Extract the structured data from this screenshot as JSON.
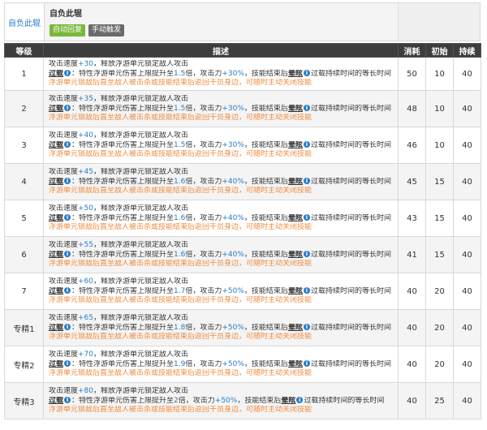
{
  "skill": {
    "name_side": "自负此辊",
    "title": "自负此辊",
    "tag_auto": "自动回复",
    "tag_manual": "手动触发"
  },
  "table": {
    "headers": {
      "level": "等级",
      "desc": "描述",
      "cost": "消耗",
      "init": "初始",
      "dur": "持续"
    },
    "rows": [
      {
        "level": "1",
        "atk_speed": "+30",
        "mult": "1.5",
        "atk": "+30%",
        "cost": "50",
        "init": "10",
        "dur": "40"
      },
      {
        "level": "2",
        "atk_speed": "+35",
        "mult": "1.5",
        "atk": "+30%",
        "cost": "48",
        "init": "10",
        "dur": "40"
      },
      {
        "level": "3",
        "atk_speed": "+40",
        "mult": "1.5",
        "atk": "+30%",
        "cost": "46",
        "init": "10",
        "dur": "40"
      },
      {
        "level": "4",
        "atk_speed": "+45",
        "mult": "1.6",
        "atk": "+40%",
        "cost": "45",
        "init": "15",
        "dur": "40"
      },
      {
        "level": "5",
        "atk_speed": "+50",
        "mult": "1.6",
        "atk": "+40%",
        "cost": "43",
        "init": "15",
        "dur": "40"
      },
      {
        "level": "6",
        "atk_speed": "+55",
        "mult": "1.6",
        "atk": "+40%",
        "cost": "41",
        "init": "15",
        "dur": "40"
      },
      {
        "level": "7",
        "atk_speed": "+60",
        "mult": "1.7",
        "atk": "+50%",
        "cost": "40",
        "init": "20",
        "dur": "40"
      },
      {
        "level": "专精1",
        "atk_speed": "+65",
        "mult": "1.8",
        "atk": "+50%",
        "cost": "40",
        "init": "20",
        "dur": "40"
      },
      {
        "level": "专精2",
        "atk_speed": "+70",
        "mult": "1.9",
        "atk": "+50%",
        "cost": "40",
        "init": "20",
        "dur": "40"
      },
      {
        "level": "专精3",
        "atk_speed": "+80",
        "mult": "2",
        "atk": "+50%",
        "cost": "40",
        "init": "25",
        "dur": "40"
      }
    ]
  },
  "desc_text": {
    "l1_pre": "攻击速度",
    "l1_post": "，释放浮游单元锁定敌人攻击",
    "overload": "过载",
    "info_glyph": "i",
    "l2_a": "：特性浮游单元伤害上限提升至",
    "l2_b": "倍，攻击力",
    "l2_c": "，技能结束后",
    "dizzy": "晕眩",
    "l2_d": "过载持续时间的等长时间",
    "l3": "浮游单元锁敌后直至敌人被击杀或技能结束后返回干员身边，可随时主动关闭技能"
  },
  "colors": {
    "accent_blue": "#2a7cc7",
    "orange": "#f08a3c",
    "header_bg": "#3d3d3d"
  }
}
